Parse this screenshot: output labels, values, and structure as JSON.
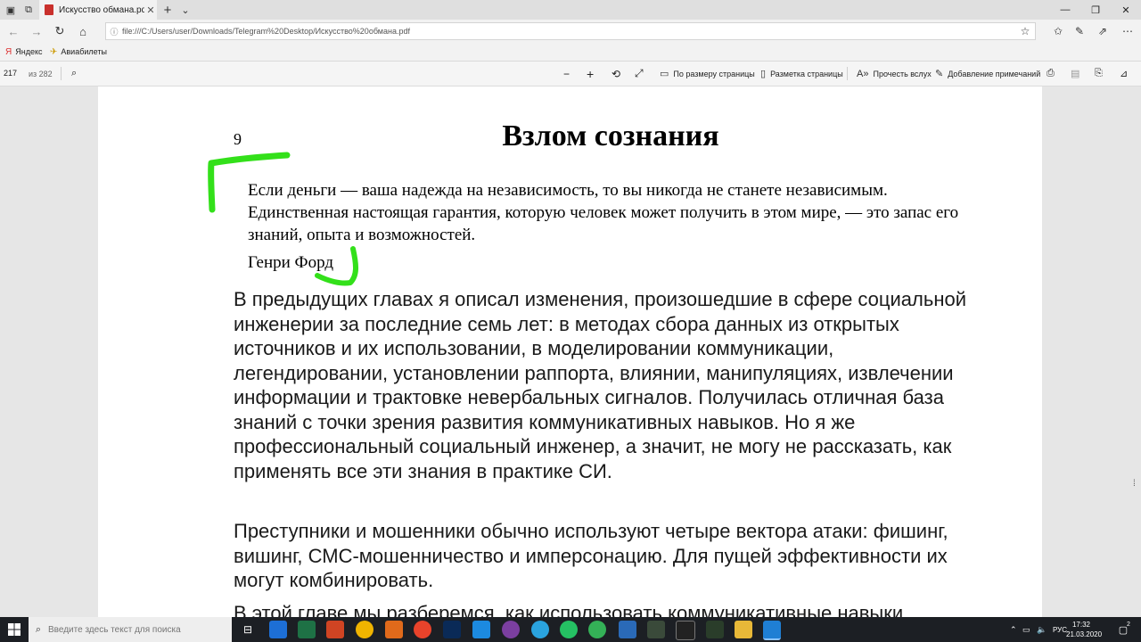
{
  "tab": {
    "title": "Искусство обмана.pdf"
  },
  "address": {
    "url": "file:///C:/Users/user/Downloads/Telegram%20Desktop/Искусство%20обмана.pdf"
  },
  "favorites": [
    {
      "label": "Яндекс",
      "icon": "yandex-icon"
    },
    {
      "label": "Авиабилеты",
      "icon": "plane-icon"
    }
  ],
  "pdf_toolbar": {
    "page": "217",
    "of_pages": "из 282",
    "fit_page": "По размеру страницы",
    "page_layout": "Разметка страницы",
    "read_aloud": "Прочесть вслух",
    "add_notes": "Добавление примечаний"
  },
  "document": {
    "page_number": "9",
    "chapter_title": "Взлом сознания",
    "epigraph": "Если деньги — ваша надежда на независимость, то вы никогда не станете независимым. Единственная настоящая гарантия, которую человек может получить в этом мире, — это запас его знаний, опыта и возможностей.",
    "epigraph_author": "Генри Форд",
    "paragraphs": [
      "В предыдущих главах я описал изменения, произошедшие в сфере социальной инженерии за последние семь лет: в методах сбора данных из открытых источников и их использовании, в моделировании коммуникации, легендировании, установлении раппорта, влиянии, манипуляциях, извлечении информации и трактовке невербальных сигналов. Получилась отличная база знаний с точки зрения развития коммуникативных навыков. Но я же профессиональный социальный инженер, а значит, не могу не рассказать, как применять все эти знания в практике СИ.",
      "Преступники и мошенники обычно используют четыре вектора атаки: фишинг, вишинг, СМС-мошенничество и имперсонацию. Для пущей эффективности их могут комбинировать.",
      "В этой главе мы разберемся, как использовать коммуникативные навыки"
    ],
    "annotation_color": "#33e01a"
  },
  "taskbar": {
    "search_placeholder": "Введите здесь текст для поиска",
    "language": "РУС",
    "time": "17:32",
    "date": "21.03.2020",
    "notification_count": "2"
  }
}
